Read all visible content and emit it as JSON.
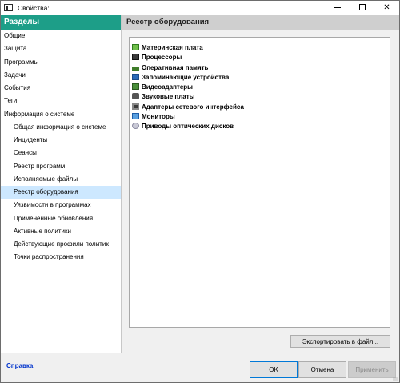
{
  "window": {
    "title": "Свойства:"
  },
  "left": {
    "header": "Разделы",
    "items": [
      {
        "label": "Общие"
      },
      {
        "label": "Защита"
      },
      {
        "label": "Программы"
      },
      {
        "label": "Задачи"
      },
      {
        "label": "События"
      },
      {
        "label": "Теги"
      },
      {
        "label": "Информация о системе"
      },
      {
        "label": "Общая информация о системе"
      },
      {
        "label": "Инциденты"
      },
      {
        "label": "Сеансы"
      },
      {
        "label": "Реестр программ"
      },
      {
        "label": "Исполняемые файлы"
      },
      {
        "label": "Реестр оборудования"
      },
      {
        "label": "Уязвимости в программах"
      },
      {
        "label": "Примененные обновления"
      },
      {
        "label": "Активные политики"
      },
      {
        "label": "Действующие профили политик"
      },
      {
        "label": "Точки распространения"
      }
    ]
  },
  "right": {
    "header": "Реестр оборудования",
    "hardware": [
      {
        "label": "Материнская плата",
        "icon": "motherboard-icon"
      },
      {
        "label": "Процессоры",
        "icon": "cpu-icon"
      },
      {
        "label": "Оперативная память",
        "icon": "ram-icon"
      },
      {
        "label": "Запоминающие устройства",
        "icon": "storage-icon"
      },
      {
        "label": "Видеоадаптеры",
        "icon": "video-adapter-icon"
      },
      {
        "label": "Звуковые платы",
        "icon": "sound-card-icon"
      },
      {
        "label": "Адаптеры сетевого интерфейса",
        "icon": "network-adapter-icon"
      },
      {
        "label": "Мониторы",
        "icon": "monitor-icon"
      },
      {
        "label": "Приводы оптических дисков",
        "icon": "optical-drive-icon"
      }
    ],
    "export_label": "Экспортировать в файл..."
  },
  "footer": {
    "help": "Справка",
    "ok": "OK",
    "cancel": "Отмена",
    "apply": "Применить"
  },
  "colors": {
    "accent": "#1d9e88",
    "selection": "#cde8ff",
    "link": "#0033cc"
  }
}
